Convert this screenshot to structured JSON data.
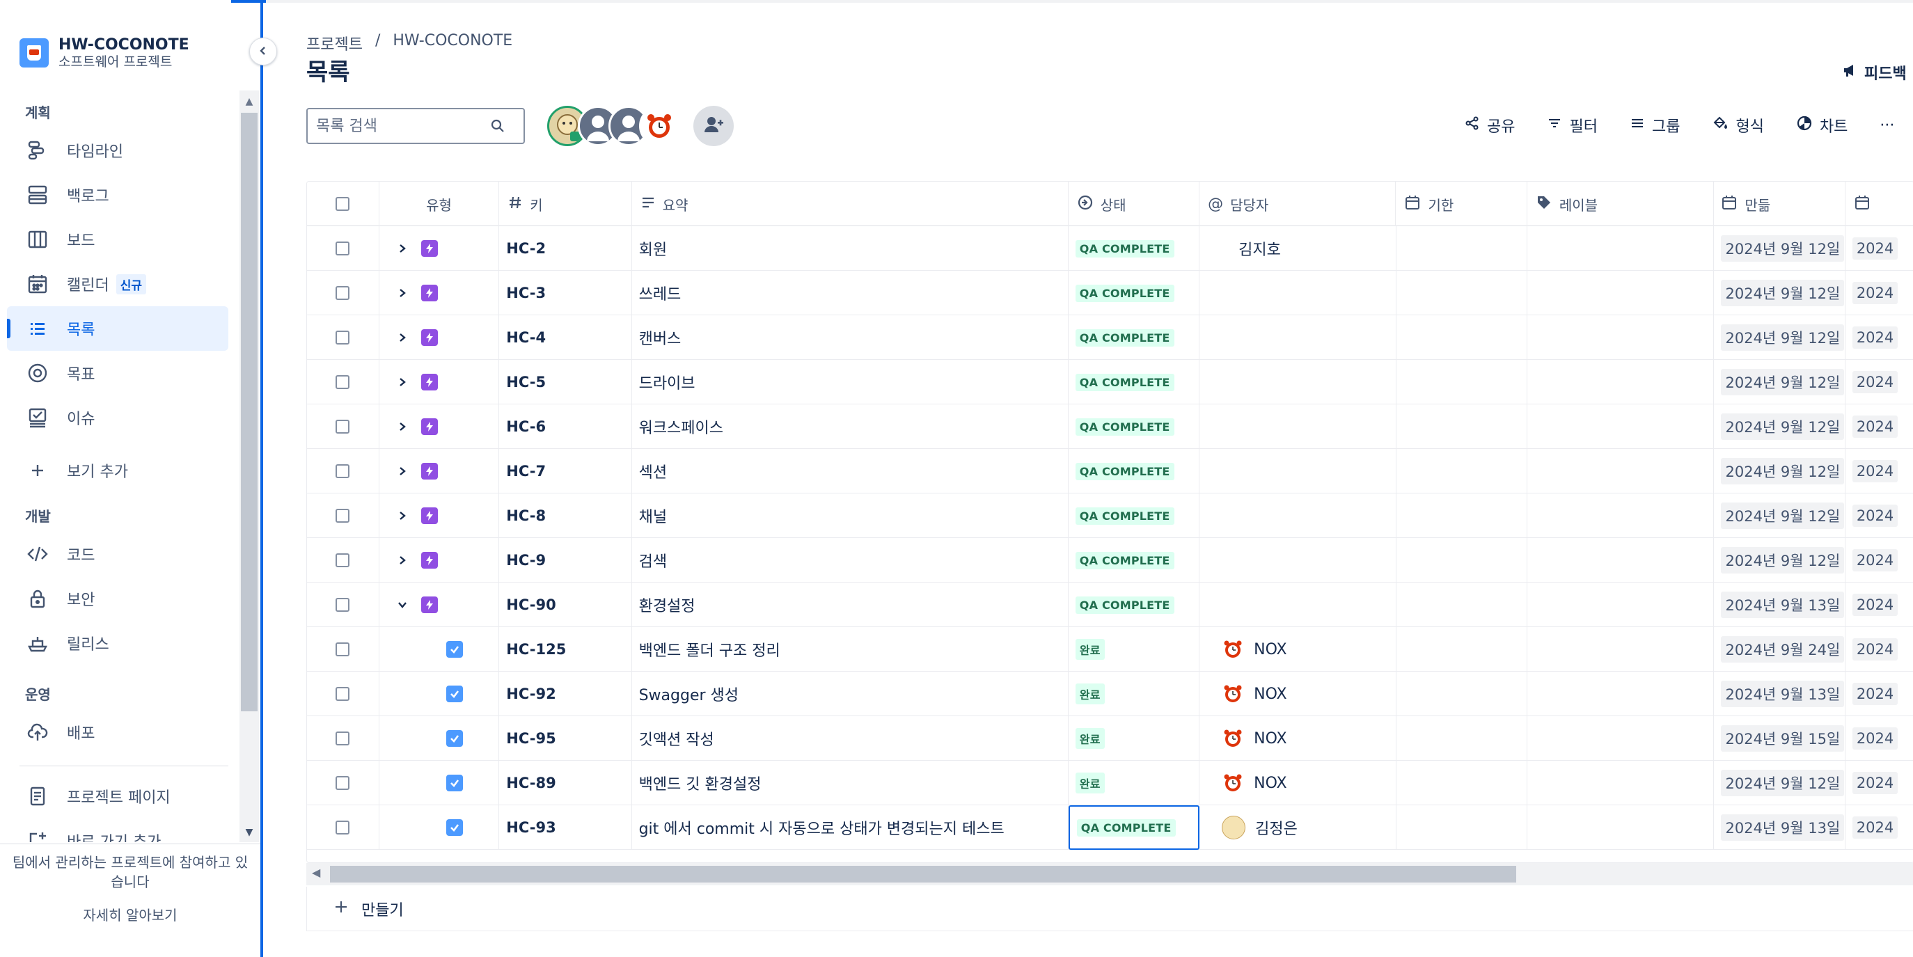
{
  "project": {
    "name": "HW-COCONOTE",
    "subtitle": "소프트웨어 프로젝트"
  },
  "sidebar": {
    "section_plan": "계획",
    "section_dev": "개발",
    "section_ops": "운영",
    "items": {
      "timeline": "타임라인",
      "backlog": "백로그",
      "board": "보드",
      "calendar": "캘린더",
      "calendar_badge": "신규",
      "list": "목록",
      "goals": "목표",
      "issues": "이슈",
      "add_view": "보기 추가",
      "code": "코드",
      "security": "보안",
      "releases": "릴리스",
      "deploy": "배포",
      "project_pages": "프로젝트 페이지",
      "add_shortcut": "바로 가기 추가"
    },
    "footer_text": "팀에서 관리하는 프로젝트에 참여하고 있습니다",
    "footer_link": "자세히 알아보기"
  },
  "header": {
    "breadcrumb": [
      "프로젝트",
      "/",
      "HW-COCONOTE"
    ],
    "title": "목록",
    "feedback": "피드백"
  },
  "search": {
    "placeholder": "목록 검색"
  },
  "toolbar": {
    "share": "공유",
    "filter": "필터",
    "group": "그룹",
    "format": "형식",
    "chart": "차트",
    "more": "···"
  },
  "table": {
    "columns": {
      "type": "유형",
      "key": "키",
      "summary": "요약",
      "status": "상태",
      "assignee": "담당자",
      "due": "기한",
      "labels": "레이블",
      "created": "만듦"
    },
    "rows": [
      {
        "key": "HC-2",
        "summary": "회원",
        "status": "QA COMPLETE",
        "assignee": "김지호",
        "created": "2024년 9월 12일",
        "extra": "2024"
      },
      {
        "key": "HC-3",
        "summary": "쓰레드",
        "status": "QA COMPLETE",
        "assignee": "",
        "created": "2024년 9월 12일",
        "extra": "2024"
      },
      {
        "key": "HC-4",
        "summary": "캔버스",
        "status": "QA COMPLETE",
        "assignee": "",
        "created": "2024년 9월 12일",
        "extra": "2024"
      },
      {
        "key": "HC-5",
        "summary": "드라이브",
        "status": "QA COMPLETE",
        "assignee": "",
        "created": "2024년 9월 12일",
        "extra": "2024"
      },
      {
        "key": "HC-6",
        "summary": "워크스페이스",
        "status": "QA COMPLETE",
        "assignee": "",
        "created": "2024년 9월 12일",
        "extra": "2024"
      },
      {
        "key": "HC-7",
        "summary": "섹션",
        "status": "QA COMPLETE",
        "assignee": "",
        "created": "2024년 9월 12일",
        "extra": "2024"
      },
      {
        "key": "HC-8",
        "summary": "채널",
        "status": "QA COMPLETE",
        "assignee": "",
        "created": "2024년 9월 12일",
        "extra": "2024"
      },
      {
        "key": "HC-9",
        "summary": "검색",
        "status": "QA COMPLETE",
        "assignee": "",
        "created": "2024년 9월 12일",
        "extra": "2024"
      },
      {
        "key": "HC-90",
        "summary": "환경설정",
        "status": "QA COMPLETE",
        "assignee": "",
        "created": "2024년 9월 13일",
        "extra": "2024"
      },
      {
        "key": "HC-125",
        "summary": "백엔드 폴더 구조 정리",
        "status": "완료",
        "assignee": "NOX",
        "created": "2024년 9월 24일",
        "extra": "2024"
      },
      {
        "key": "HC-92",
        "summary": "Swagger 생성",
        "status": "완료",
        "assignee": "NOX",
        "created": "2024년 9월 13일",
        "extra": "2024"
      },
      {
        "key": "HC-95",
        "summary": "깃액션 작성",
        "status": "완료",
        "assignee": "NOX",
        "created": "2024년 9월 15일",
        "extra": "2024"
      },
      {
        "key": "HC-89",
        "summary": "백엔드 깃 환경설정",
        "status": "완료",
        "assignee": "NOX",
        "created": "2024년 9월 12일",
        "extra": "2024"
      },
      {
        "key": "HC-93",
        "summary": "git 에서 commit 시 자동으로 상태가 변경되는지 테스트",
        "status": "QA COMPLETE",
        "assignee": "김정은",
        "created": "2024년 9월 13일",
        "extra": "2024"
      }
    ]
  },
  "create_label": "만들기"
}
